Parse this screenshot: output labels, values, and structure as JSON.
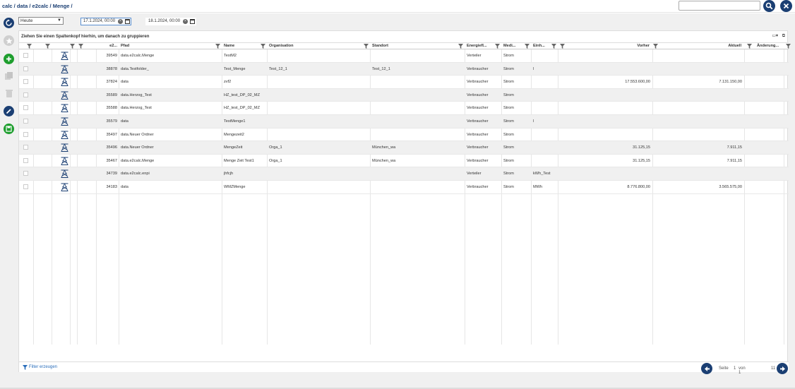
{
  "breadcrumb": "calc / data / e2calc / Menge /",
  "filters": {
    "period": "Heute",
    "date_from": "17.1.2024, 00:00",
    "date_to": "18.1.2024, 00:00"
  },
  "grid": {
    "group_hint": "Ziehen Sie einen Spaltenkopf hierhin, um danach zu gruppieren",
    "columns": [
      "e2...",
      "Pfad",
      "Name",
      "Organisation",
      "Standort",
      "Energiefl...",
      "Medi...",
      "Einh...",
      "Vorher",
      "Aktuell",
      "Änderung...",
      "Z..."
    ],
    "rows": [
      {
        "id": "39549",
        "pfad": "data.e2calc.Menge",
        "name": "TestM2",
        "org": "",
        "standort": "",
        "energie": "Verteiler",
        "medium": "Strom",
        "einheit": "",
        "vorher": "",
        "aktuell": ""
      },
      {
        "id": "38878",
        "pfad": "data.Testfolder_",
        "name": "Test_Menge",
        "org": "Test_12_1",
        "standort": "Test_12_1",
        "energie": "Verbraucher",
        "medium": "Strom",
        "einheit": "l",
        "vorher": "",
        "aktuell": ""
      },
      {
        "id": "37824",
        "pfad": "data",
        "name": "zvf2",
        "org": "",
        "standort": "",
        "energie": "Verbraucher",
        "medium": "Strom",
        "einheit": "",
        "vorher": "17.553.600,00",
        "aktuell": "7.131.150,00"
      },
      {
        "id": "35589",
        "pfad": "data.Herzog_Test",
        "name": "HZ_test_DP_02_MZ",
        "org": "",
        "standort": "",
        "energie": "Verbraucher",
        "medium": "Strom",
        "einheit": "",
        "vorher": "",
        "aktuell": ""
      },
      {
        "id": "35588",
        "pfad": "data.Herzog_Test",
        "name": "HZ_test_DP_02_MZ",
        "org": "",
        "standort": "",
        "energie": "Verbraucher",
        "medium": "Strom",
        "einheit": "",
        "vorher": "",
        "aktuell": ""
      },
      {
        "id": "35579",
        "pfad": "data",
        "name": "TestMenge1",
        "org": "",
        "standort": "",
        "energie": "Verbraucher",
        "medium": "Strom",
        "einheit": "l",
        "vorher": "",
        "aktuell": ""
      },
      {
        "id": "35497",
        "pfad": "data.Neuer Ordner",
        "name": "Mengezeit2",
        "org": "",
        "standort": "",
        "energie": "Verbraucher",
        "medium": "Strom",
        "einheit": "",
        "vorher": "",
        "aktuell": ""
      },
      {
        "id": "35496",
        "pfad": "data.Neuer Ordner",
        "name": "MengeZeit",
        "org": "Orga_1",
        "standort": "München_wa",
        "energie": "Verbraucher",
        "medium": "Strom",
        "einheit": "",
        "vorher": "31.125,15",
        "aktuell": "7.911,15"
      },
      {
        "id": "35467",
        "pfad": "data.e2calc.Menge",
        "name": "Menge Zeit Test1",
        "org": "Orga_1",
        "standort": "München_wa",
        "energie": "Verbraucher",
        "medium": "Strom",
        "einheit": "",
        "vorher": "31.125,15",
        "aktuell": "7.911,15"
      },
      {
        "id": "34739",
        "pfad": "data.e2calc.enpi",
        "name": "jhfcjh",
        "org": "",
        "standort": "",
        "energie": "Verteiler",
        "medium": "Strom",
        "einheit": "kWh_Test",
        "vorher": "",
        "aktuell": ""
      },
      {
        "id": "34183",
        "pfad": "data",
        "name": "WMZMenge",
        "org": "",
        "standort": "",
        "energie": "Verbraucher",
        "medium": "Strom",
        "einheit": "MWh",
        "vorher": "8.776.800,00",
        "aktuell": "3.565.575,00"
      }
    ]
  },
  "filter_create": "Filter erzeugen",
  "pager": {
    "page_label": "Seite",
    "page": "1",
    "of_label": "von 1",
    "count": "11"
  },
  "colors": {
    "navy": "#1b3f73",
    "green": "#1e9e2e",
    "link": "#2a6ebb"
  }
}
